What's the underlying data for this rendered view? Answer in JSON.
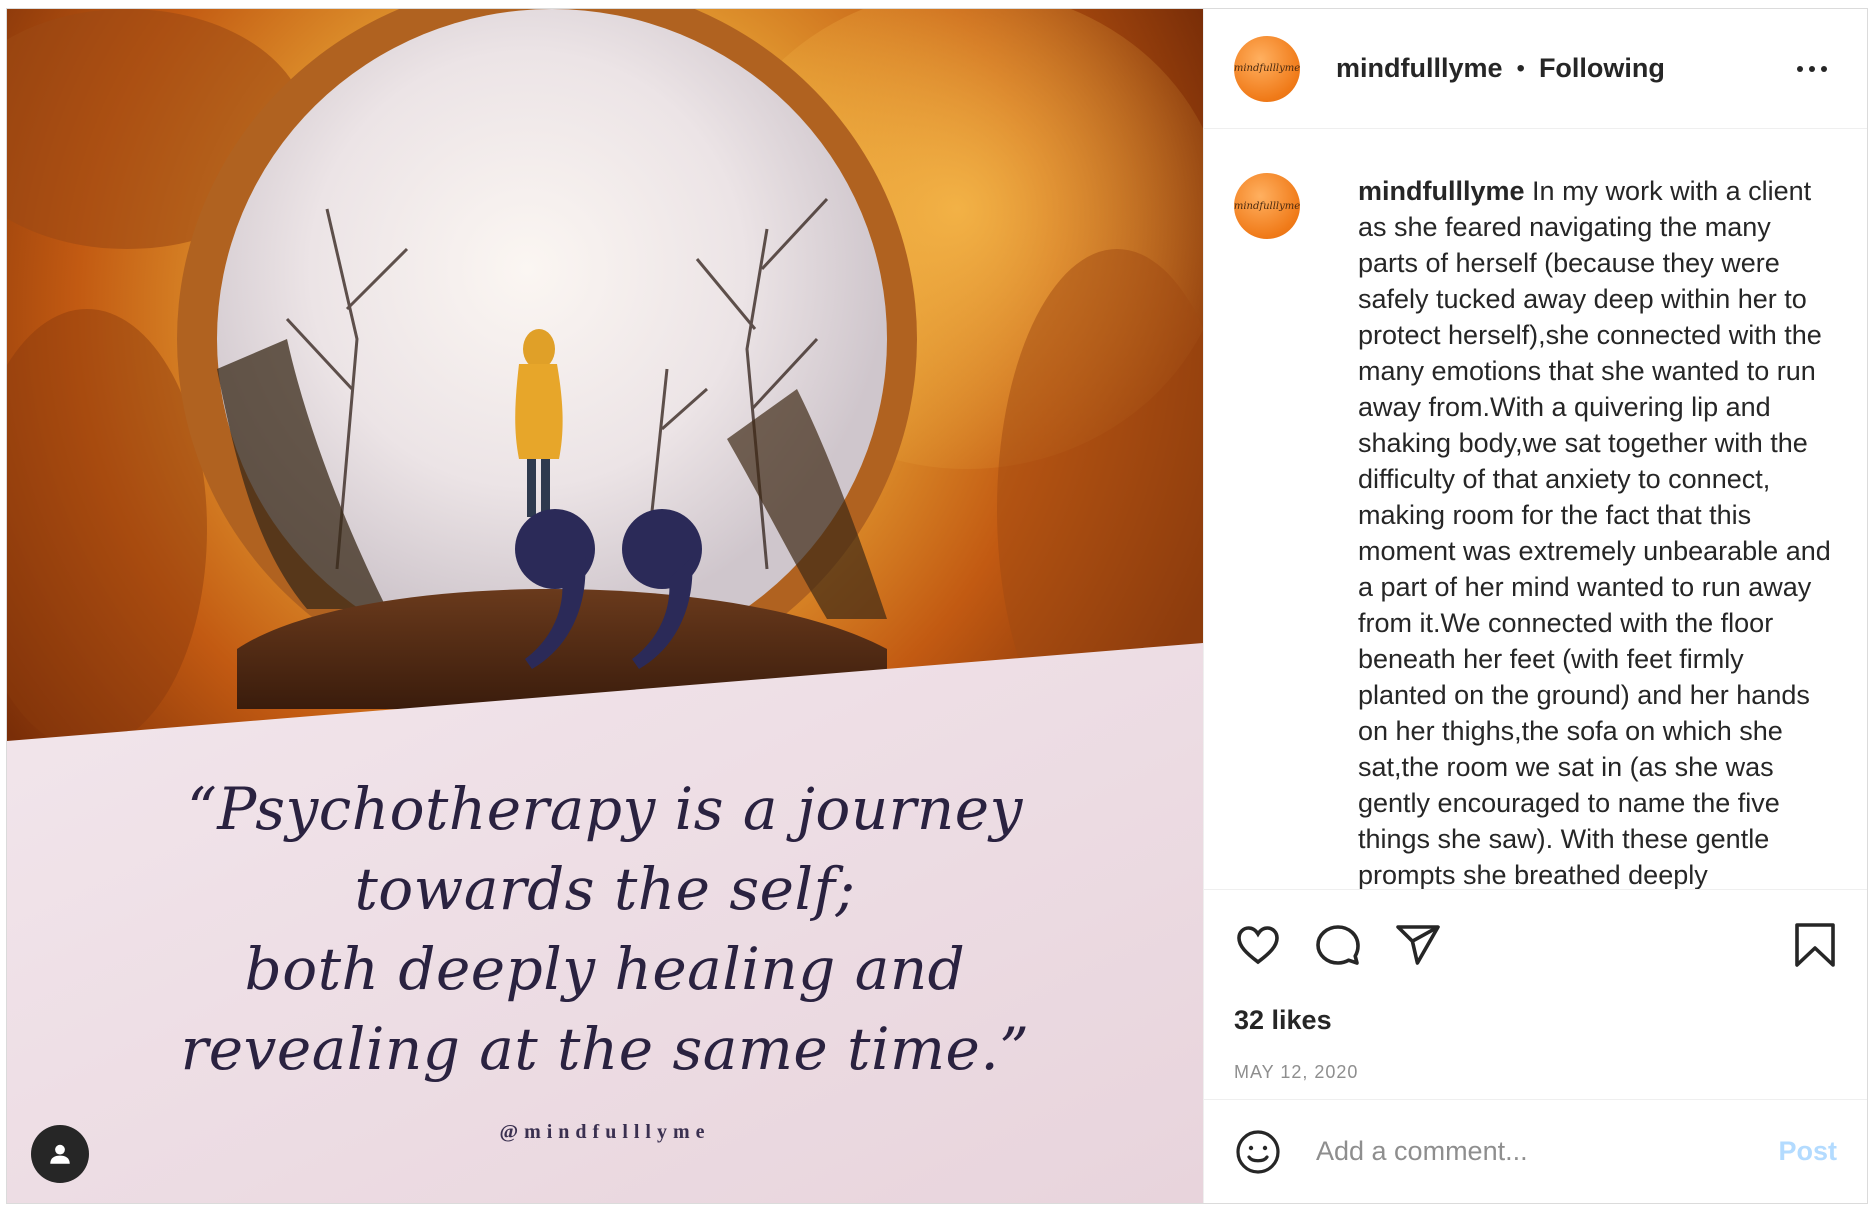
{
  "post": {
    "username": "mindfulllyme",
    "follow_status": "Following",
    "avatar_text": "mindfulllyme",
    "caption_user": "mindfulllyme",
    "caption_text": "In my work with a client as she feared navigating the many parts of herself (because they were safely tucked away deep within her to protect herself),she connected with the many emotions that she wanted to run away from.With a quivering lip and shaking body,we sat together with the difficulty of that anxiety to connect, making room for the fact that this moment was extremely unbearable and a part of her mind wanted to run away from it.We connected with the floor beneath her feet (with feet firmly planted on the ground) and her hands on her thighs,the sofa on which she sat,the room we sat in (as she was gently encouraged to name the five things she saw). With these gentle prompts she breathed deeply",
    "likes": "32 likes",
    "date": "MAY 12, 2020"
  },
  "image": {
    "quote_lines": [
      "“Psychotherapy is a journey",
      "towards the self;",
      "both deeply healing and",
      "revealing at the same time.”"
    ],
    "handle": "@mindfulllyme"
  },
  "comment": {
    "placeholder": "Add a comment...",
    "post_label": "Post"
  },
  "icons": {
    "more": "more-options-icon",
    "like": "heart-icon",
    "comment": "comment-icon",
    "share": "share-icon",
    "save": "bookmark-icon",
    "emoji": "emoji-icon",
    "tagged": "user-tag-icon"
  },
  "colors": {
    "accent_post_disabled": "#b3dbff",
    "quote_text": "#2a2240",
    "secondary_text": "#8e8e8e"
  }
}
